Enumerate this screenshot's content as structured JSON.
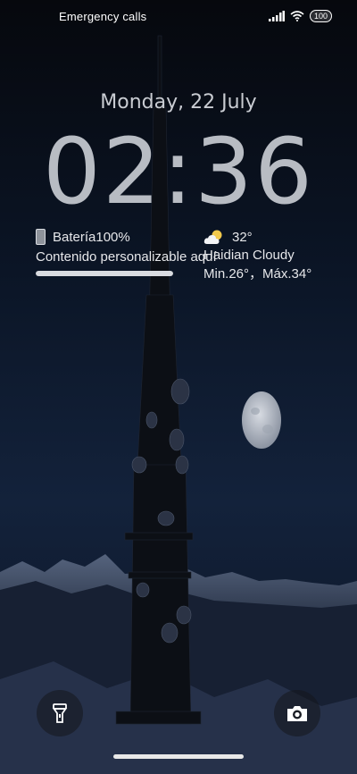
{
  "status_bar": {
    "carrier": "Emergency calls",
    "battery": "100",
    "icons": [
      "signal-icon",
      "wifi-icon",
      "battery-icon"
    ]
  },
  "lock": {
    "date": "Monday, 22 July",
    "time": "02:36"
  },
  "widget_left": {
    "battery_label": "Batería100%",
    "battery_fraction": 1.0,
    "custom_text": "Contenido personalizable aquí",
    "icon": "phone-icon"
  },
  "widget_right": {
    "temperature": "32°",
    "location": "Haidian  Cloudy",
    "range": "Min.26°，Máx.34°",
    "icon": "partly-cloudy-icon"
  },
  "shortcuts": {
    "left": "flashlight-icon",
    "right": "camera-icon"
  },
  "colors": {
    "clock": "#b8bcc3",
    "text": "#e6e7ea",
    "sky_top": "#06080d",
    "sky_bottom": "#13223b"
  }
}
